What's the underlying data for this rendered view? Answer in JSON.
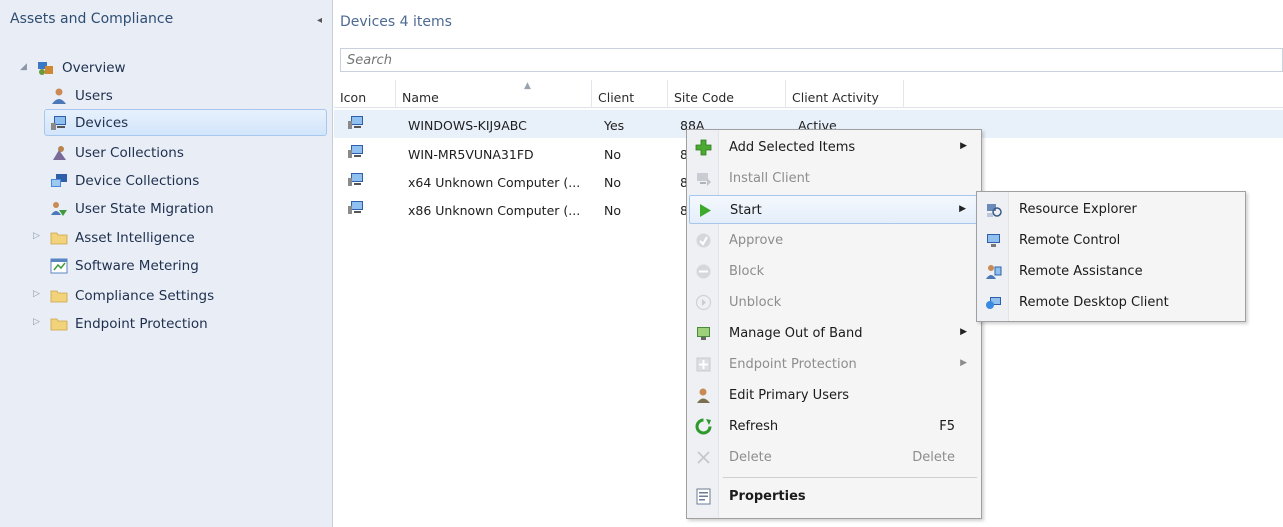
{
  "nav": {
    "header": "Assets and Compliance",
    "collapse_glyph": "◂",
    "items": [
      {
        "label": "Overview",
        "icon": "overview-icon"
      },
      {
        "label": "Users",
        "icon": "users-icon"
      },
      {
        "label": "Devices",
        "icon": "devices-icon"
      },
      {
        "label": "User Collections",
        "icon": "user-collections-icon"
      },
      {
        "label": "Device Collections",
        "icon": "device-collections-icon"
      },
      {
        "label": "User State Migration",
        "icon": "user-state-migration-icon"
      },
      {
        "label": "Asset Intelligence",
        "icon": "folder-icon"
      },
      {
        "label": "Software Metering",
        "icon": "software-metering-icon"
      },
      {
        "label": "Compliance Settings",
        "icon": "folder-icon"
      },
      {
        "label": "Endpoint Protection",
        "icon": "folder-icon"
      }
    ]
  },
  "main": {
    "title": "Devices 4 items",
    "search_placeholder": "Search",
    "columns": [
      "Icon",
      "Name",
      "Client",
      "Site Code",
      "Client Activity"
    ],
    "rows": [
      {
        "name": "WINDOWS-KIJ9ABC",
        "client": "Yes",
        "site": "88A",
        "activity": "Active"
      },
      {
        "name": "WIN-MR5VUNA31FD",
        "client": "No",
        "site": "8",
        "activity": ""
      },
      {
        "name": "x64 Unknown Computer (...",
        "client": "No",
        "site": "8",
        "activity": ""
      },
      {
        "name": "x86 Unknown Computer (...",
        "client": "No",
        "site": "8",
        "activity": ""
      }
    ]
  },
  "context_menu": {
    "items": [
      {
        "label": "Add Selected Items",
        "shortcut": "",
        "submenu": true,
        "disabled": false
      },
      {
        "label": "Install Client",
        "shortcut": "",
        "submenu": false,
        "disabled": true
      },
      {
        "label": "Start",
        "shortcut": "",
        "submenu": true,
        "disabled": false
      },
      {
        "label": "Approve",
        "shortcut": "",
        "submenu": false,
        "disabled": true
      },
      {
        "label": "Block",
        "shortcut": "",
        "submenu": false,
        "disabled": true
      },
      {
        "label": "Unblock",
        "shortcut": "",
        "submenu": false,
        "disabled": true
      },
      {
        "label": "Manage Out of Band",
        "shortcut": "",
        "submenu": true,
        "disabled": false
      },
      {
        "label": "Endpoint Protection",
        "shortcut": "",
        "submenu": true,
        "disabled": true
      },
      {
        "label": "Edit Primary Users",
        "shortcut": "",
        "submenu": false,
        "disabled": false
      },
      {
        "label": "Refresh",
        "shortcut": "F5",
        "submenu": false,
        "disabled": false
      },
      {
        "label": "Delete",
        "shortcut": "Delete",
        "submenu": false,
        "disabled": true
      },
      {
        "label": "Properties",
        "shortcut": "",
        "submenu": false,
        "disabled": false
      }
    ]
  },
  "start_submenu": {
    "items": [
      {
        "label": "Resource Explorer",
        "icon": "resource-explorer-icon"
      },
      {
        "label": "Remote Control",
        "icon": "remote-control-icon"
      },
      {
        "label": "Remote Assistance",
        "icon": "remote-assistance-icon"
      },
      {
        "label": "Remote Desktop Client",
        "icon": "remote-desktop-icon"
      }
    ]
  },
  "colors": {
    "nav_bg": "#e9eef6",
    "header_text": "#2f4d73",
    "selection_border": "#a7c7ee",
    "menu_bg": "#f5f5f5"
  }
}
